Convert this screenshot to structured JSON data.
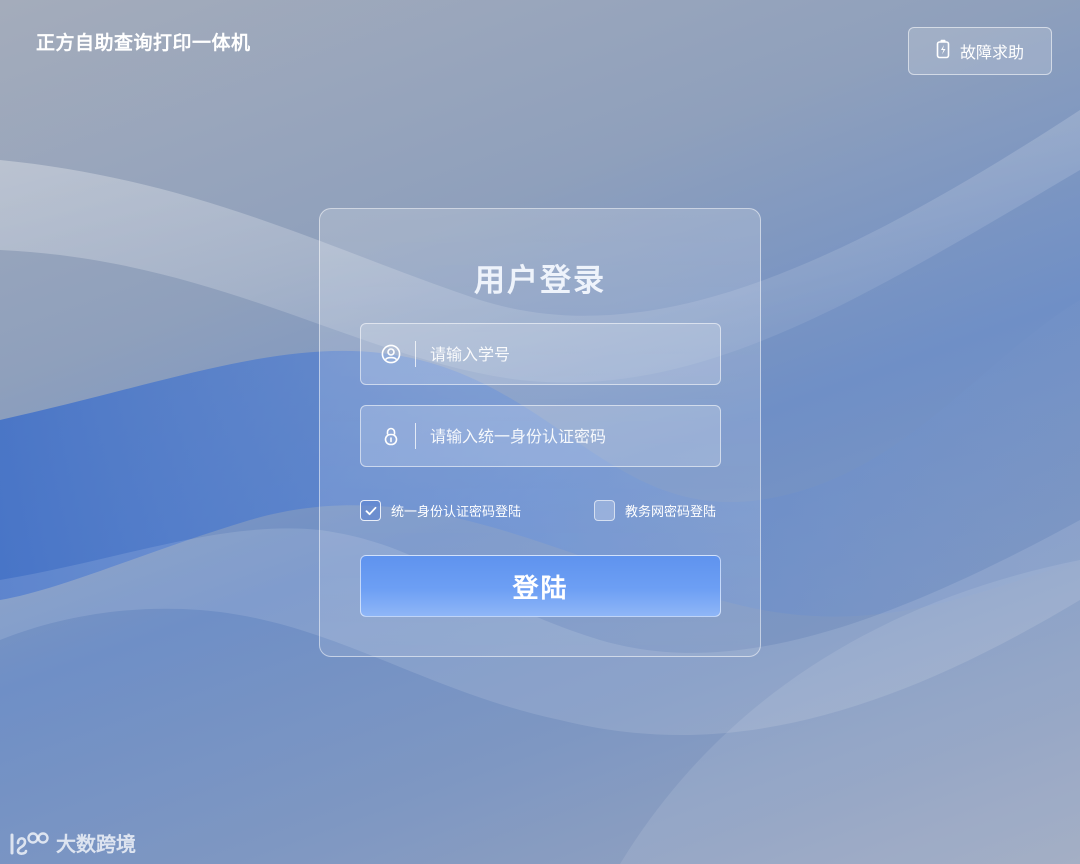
{
  "app": {
    "title": "正方自助查询打印一体机"
  },
  "header": {
    "help_label": "故障求助",
    "help_icon": "battery-icon"
  },
  "login": {
    "title": "用户登录",
    "student_id": {
      "placeholder": "请输入学号",
      "value": "",
      "icon": "user-circle-icon"
    },
    "password": {
      "placeholder": "请输入统一身份认证密码",
      "value": "",
      "icon": "lock-icon"
    },
    "options": [
      {
        "label": "统一身份认证密码登陆",
        "checked": true
      },
      {
        "label": "教务网密码登陆",
        "checked": false
      }
    ],
    "submit_label": "登陆"
  },
  "watermark": {
    "text": "大数跨境",
    "logo": "1s0-logo"
  },
  "colors": {
    "accent": "#6a9cf2",
    "background": "#8fa0bc"
  }
}
